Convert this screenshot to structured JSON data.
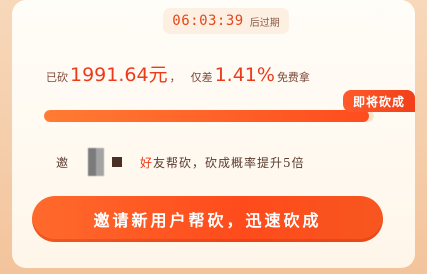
{
  "timer": {
    "time": "06:03:39",
    "suffix": "后过期"
  },
  "cut_line": {
    "prefix": "已砍",
    "amount": "1991.64元",
    "sep": "，",
    "middle": "仅差",
    "percent": "1.41%",
    "suffix": "免费拿"
  },
  "progress": {
    "fraction": 0.985,
    "badge": "即将砍成"
  },
  "invite": {
    "prefix": "邀",
    "highlight": "好",
    "text": "友帮砍，砍成概率提升5倍"
  },
  "cta": {
    "label": "邀请新用户帮砍，迅速砍成"
  },
  "colors": {
    "accent": "#ec3b1b",
    "button": "#ff4b1c",
    "background": "#fff6ea"
  }
}
